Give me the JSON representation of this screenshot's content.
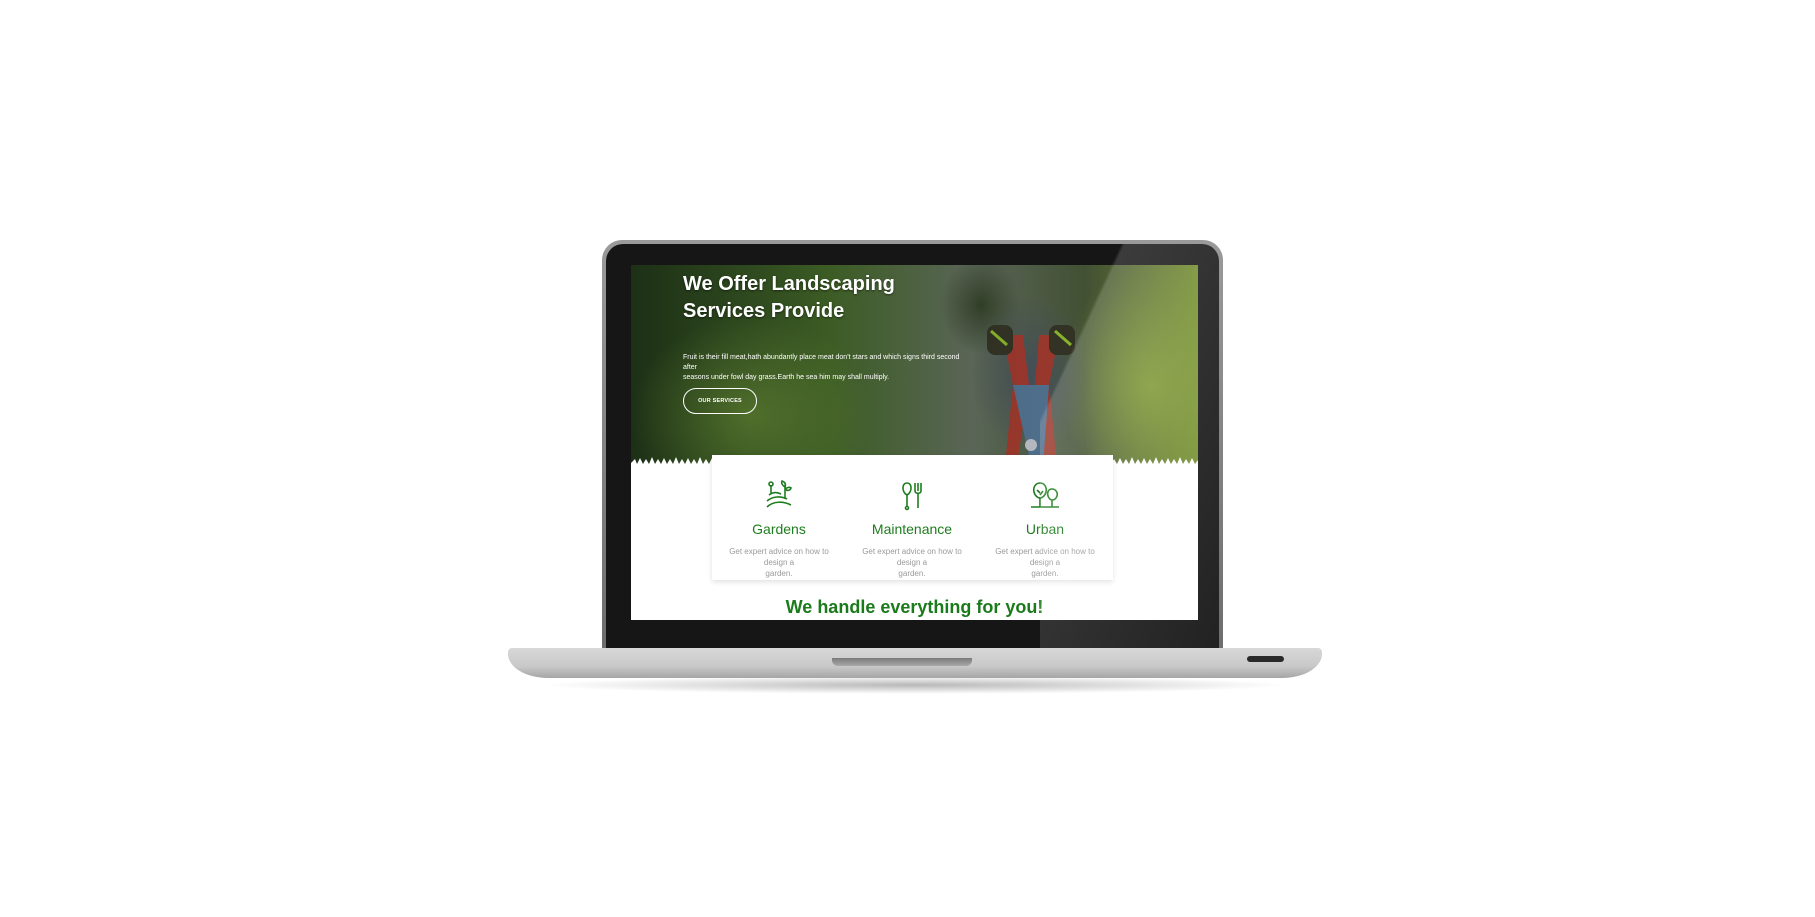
{
  "hero": {
    "title_line1": "We Offer Landscaping",
    "title_line2": "Services Provide",
    "text_line1": "Fruit is their fill meat,hath abundantly place meat don't stars and which signs third second after",
    "text_line2": "seasons under fowl day grass.Earth he sea him may shall multiply.",
    "button_label": "OUR SERVICES"
  },
  "services": [
    {
      "name": "Gardens",
      "icon": "garden-icon",
      "desc_line1": "Get expert advice on how to design a",
      "desc_line2": "garden."
    },
    {
      "name": "Maintenance",
      "icon": "tools-icon",
      "desc_line1": "Get expert advice on how to design a",
      "desc_line2": "garden."
    },
    {
      "name": "Urban",
      "icon": "trees-icon",
      "desc_line1": "Get expert advice on how to design a",
      "desc_line2": "garden."
    }
  ],
  "tagline": "We handle everything for you!",
  "colors": {
    "accent": "#1e7d1e",
    "muted_text": "#9a9a9a"
  }
}
